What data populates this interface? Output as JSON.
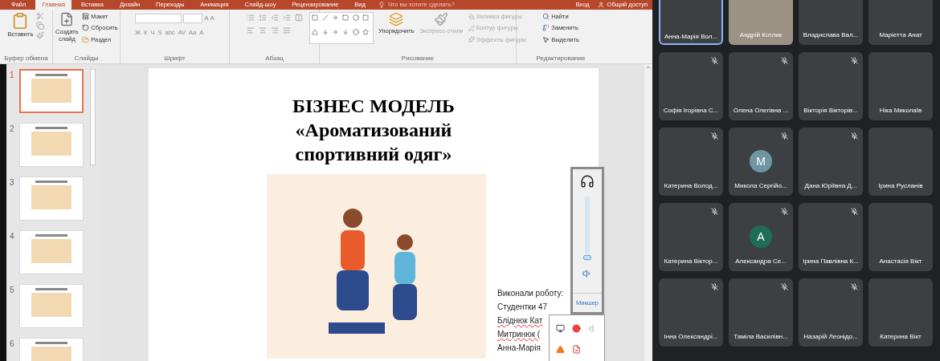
{
  "ribbon": {
    "tabs": [
      {
        "label": "Файл",
        "selected": false
      },
      {
        "label": "Главная",
        "selected": true
      },
      {
        "label": "Вставка",
        "selected": false
      },
      {
        "label": "Дизайн",
        "selected": false
      },
      {
        "label": "Переходы",
        "selected": false
      },
      {
        "label": "Анимация",
        "selected": false
      },
      {
        "label": "Слайд-шоу",
        "selected": false
      },
      {
        "label": "Рецензирование",
        "selected": false
      },
      {
        "label": "Вид",
        "selected": false
      }
    ],
    "tell_me": "Что вы хотите сделать?",
    "sign_in": "Вход",
    "share": "Общий доступ",
    "clipboard": {
      "title": "Буфер обмена",
      "paste": "Вставить"
    },
    "slides": {
      "title": "Слайды",
      "new_slide": "Создать слайд",
      "layout": "Макет",
      "reset": "Сбросить",
      "section": "Раздел"
    },
    "font": {
      "title": "Шрифт",
      "size_buttons": [
        "A",
        "A"
      ],
      "buttons": [
        "Ж",
        "К",
        "Ч",
        "S",
        "abc",
        "AV",
        "Aa",
        "A"
      ]
    },
    "paragraph": {
      "title": "Абзац"
    },
    "drawing": {
      "title": "Рисование",
      "arrange": "Упорядочить",
      "quick_styles": {
        "label": "Экспресс-стили",
        "disabled": true
      },
      "shape_commands": [
        {
          "label": "Заливка фигуры",
          "disabled": true
        },
        {
          "label": "Контур фигуры",
          "disabled": true
        },
        {
          "label": "Эффекты фигуры",
          "disabled": true
        }
      ]
    },
    "editing": {
      "title": "Редактирование",
      "find": "Найти",
      "replace": "Заменить",
      "select": "Выделить"
    }
  },
  "thumbnails": [
    {
      "number": "1",
      "selected": true
    },
    {
      "number": "2",
      "selected": false
    },
    {
      "number": "3",
      "selected": false
    },
    {
      "number": "4",
      "selected": false
    },
    {
      "number": "5",
      "selected": false
    },
    {
      "number": "6",
      "selected": false
    }
  ],
  "slide": {
    "title_lines": [
      "БІЗНЕС МОДЕЛЬ",
      "«Ароматизований",
      "спортивний одяг»"
    ],
    "credits": [
      {
        "text": "Виконали роботу:",
        "flagged": false
      },
      {
        "text": "Студентки 47",
        "flagged": false
      },
      {
        "text": "Бліднюк Кат",
        "flagged": true
      },
      {
        "text": "Митринюк (",
        "flagged": true
      },
      {
        "text": "Анна-Марія",
        "flagged": false
      }
    ]
  },
  "volume_popup": {
    "level": 0.05,
    "mixer_link": "Микшер"
  },
  "participants": [
    {
      "name": "Анна-Марія Вол...",
      "kind": "photo",
      "selected": true
    },
    {
      "name": "Андрій Котлик",
      "kind": "video",
      "selected": false
    },
    {
      "name": "Владислава Вал...",
      "kind": "photo",
      "selected": false
    },
    {
      "name": "Маріетта Анат",
      "kind": "photo",
      "selected": false
    },
    {
      "name": "Софія Ігорівна С...",
      "kind": "photo",
      "muted": true,
      "selected": false
    },
    {
      "name": "Олена Олегівна ...",
      "kind": "photo",
      "muted": true,
      "selected": false
    },
    {
      "name": "Вікторія Вікторів...",
      "kind": "photo",
      "muted": true,
      "selected": false
    },
    {
      "name": "Ніка Миколаїв",
      "kind": "photo",
      "muted": false,
      "selected": false
    },
    {
      "name": "Катерина Волод...",
      "kind": "photo",
      "muted": true,
      "selected": false
    },
    {
      "name": "Микола Сергійо...",
      "kind": "letter",
      "letter": "M",
      "color": "#6f96a3",
      "muted": true,
      "selected": false
    },
    {
      "name": "Дана Юріївна Д...",
      "kind": "photo",
      "muted": true,
      "selected": false
    },
    {
      "name": "Ірина Русланів",
      "kind": "photo",
      "muted": false,
      "selected": false
    },
    {
      "name": "Катерина Віктор...",
      "kind": "photo",
      "muted": true,
      "selected": false
    },
    {
      "name": "Александра Се...",
      "kind": "letter",
      "letter": "A",
      "color": "#1e6e56",
      "muted": true,
      "selected": false
    },
    {
      "name": "Ірина Павлівна К...",
      "kind": "photo",
      "muted": true,
      "selected": false
    },
    {
      "name": "Анастасія Вікт",
      "kind": "photo",
      "muted": false,
      "selected": false
    },
    {
      "name": "Інна Олександрі...",
      "kind": "photo",
      "muted": true,
      "selected": false
    },
    {
      "name": "Таміла Василівн...",
      "kind": "photo",
      "muted": true,
      "selected": false
    },
    {
      "name": "Назарій Леонідо...",
      "kind": "photo",
      "muted": true,
      "selected": false
    },
    {
      "name": "Катерина Вікт",
      "kind": "photo",
      "muted": false,
      "selected": false
    }
  ]
}
